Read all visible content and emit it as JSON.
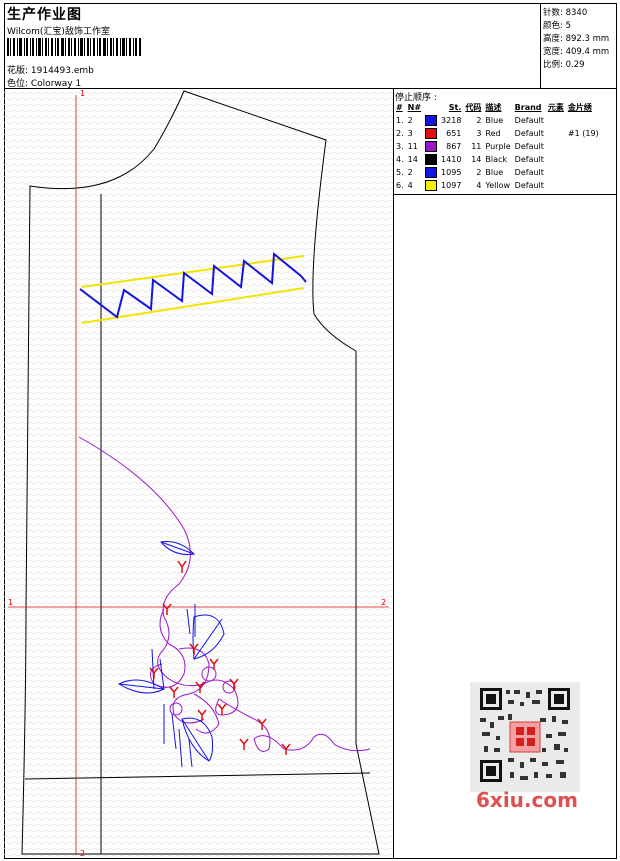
{
  "header": {
    "title": "生产作业图",
    "company": "Wilcom(汇宝)敌饰工作室",
    "design_label": "花版: 1914493.emb",
    "colorway_label": "色位: Colorway 1"
  },
  "specs": [
    {
      "label": "针数",
      "value": "8340"
    },
    {
      "label": "颜色",
      "value": "5"
    },
    {
      "label": "高度",
      "value": "892.3 mm"
    },
    {
      "label": "宽度",
      "value": "409.4 mm"
    },
    {
      "label": "比例",
      "value": "0.29"
    }
  ],
  "stop_sequence": {
    "title": "停止顺序 :",
    "columns": [
      "#",
      "N#",
      "St.",
      "代码",
      "描述",
      "Brand",
      "元素",
      "金片绣"
    ],
    "rows": [
      {
        "idx": "1.",
        "n": "2",
        "color": "#1414e0",
        "st": "3218",
        "code": "2",
        "desc": "Blue",
        "brand": "Default",
        "elem": "",
        "seq": ""
      },
      {
        "idx": "2.",
        "n": "3",
        "color": "#e01010",
        "st": "651",
        "code": "3",
        "desc": "Red",
        "brand": "Default",
        "elem": "",
        "seq": "#1 (19)"
      },
      {
        "idx": "3.",
        "n": "11",
        "color": "#9a18c8",
        "st": "867",
        "code": "11",
        "desc": "Purple",
        "brand": "Default",
        "elem": "",
        "seq": ""
      },
      {
        "idx": "4.",
        "n": "14",
        "color": "#000000",
        "st": "1410",
        "code": "14",
        "desc": "Black",
        "brand": "Default",
        "elem": "",
        "seq": ""
      },
      {
        "idx": "5.",
        "n": "2",
        "color": "#1414e0",
        "st": "1095",
        "code": "2",
        "desc": "Blue",
        "brand": "Default",
        "elem": "",
        "seq": ""
      },
      {
        "idx": "6.",
        "n": "4",
        "color": "#f0f000",
        "st": "1097",
        "code": "4",
        "desc": "Yellow",
        "brand": "Default",
        "elem": "",
        "seq": ""
      }
    ]
  },
  "guides": {
    "v_top": "1",
    "v_bottom": "2",
    "h_left": "1",
    "h_right": "2"
  },
  "watermark": "6xiu.com"
}
